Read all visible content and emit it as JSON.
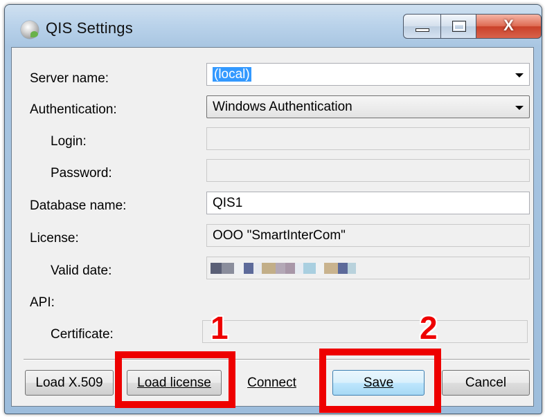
{
  "window": {
    "title": "QIS Settings",
    "close_glyph": "X"
  },
  "form": {
    "server_name": {
      "label": "Server name:",
      "value": "(local)"
    },
    "authentication": {
      "label": "Authentication:",
      "value": "Windows Authentication"
    },
    "login": {
      "label": "Login:",
      "value": ""
    },
    "password": {
      "label": "Password:",
      "value": ""
    },
    "database_name": {
      "label": "Database name:",
      "value": "QIS1"
    },
    "license": {
      "label": "License:",
      "value": "OOO \"SmartInterCom\""
    },
    "valid_date": {
      "label": "Valid date:"
    },
    "api": {
      "label": "API:"
    },
    "certificate": {
      "label": "Certificate:",
      "value": ""
    }
  },
  "buttons": {
    "load_x509": "Load X.509",
    "load_license": "Load license",
    "connect": "Connect",
    "save": "Save",
    "cancel": "Cancel"
  },
  "annotations": {
    "marker_1": "1",
    "marker_2": "2",
    "color": "#ee0000"
  },
  "icons": {
    "app": "qis-app-icon",
    "minimize": "minimize-icon",
    "maximize": "maximize-icon",
    "close": "close-icon",
    "dropdown": "chevron-down-icon"
  }
}
